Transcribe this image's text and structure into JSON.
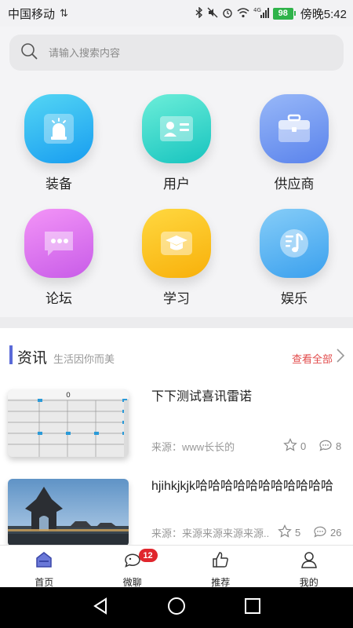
{
  "status": {
    "carrier": "中国移动",
    "battery": "98",
    "time": "傍晚5:42",
    "network": "4G"
  },
  "search": {
    "placeholder": "请输入搜索内容"
  },
  "grid": [
    {
      "label": "装备",
      "icon": "alarm-light-icon",
      "color_from": "#4fd0f2",
      "color_to": "#1a9ff0"
    },
    {
      "label": "用户",
      "icon": "id-card-icon",
      "color_from": "#66e8d4",
      "color_to": "#19c6c1"
    },
    {
      "label": "供应商",
      "icon": "briefcase-icon",
      "color_from": "#8fb0f7",
      "color_to": "#5c86ee"
    },
    {
      "label": "论坛",
      "icon": "chat-bubble-icon",
      "color_from": "#f08cf5",
      "color_to": "#c95fe9"
    },
    {
      "label": "学习",
      "icon": "graduation-cap-icon",
      "color_from": "#ffd33a",
      "color_to": "#fbb40d"
    },
    {
      "label": "娱乐",
      "icon": "music-icon",
      "color_from": "#7ec9f7",
      "color_to": "#3ba2ee"
    }
  ],
  "news": {
    "title": "资讯",
    "subtitle": "生活因你而美",
    "more": "查看全部",
    "items": [
      {
        "title": "下下测试喜讯雷诺",
        "source": "来源：www长长的",
        "likes": "0",
        "comments": "8"
      },
      {
        "title": "hjihkjkjk哈哈哈哈哈哈哈哈哈哈哈",
        "source": "来源：来源来源来源来源...",
        "likes": "5",
        "comments": "26"
      }
    ]
  },
  "tabs": [
    {
      "label": "首页",
      "icon": "home-icon",
      "active": true
    },
    {
      "label": "微聊",
      "icon": "chat-icon",
      "badge": "12"
    },
    {
      "label": "推荐",
      "icon": "thumbs-up-icon"
    },
    {
      "label": "我的",
      "icon": "user-icon"
    }
  ],
  "colors": {
    "accent": "#5a6ad8",
    "more_link": "#e24b4b",
    "badge": "#e0262d"
  }
}
